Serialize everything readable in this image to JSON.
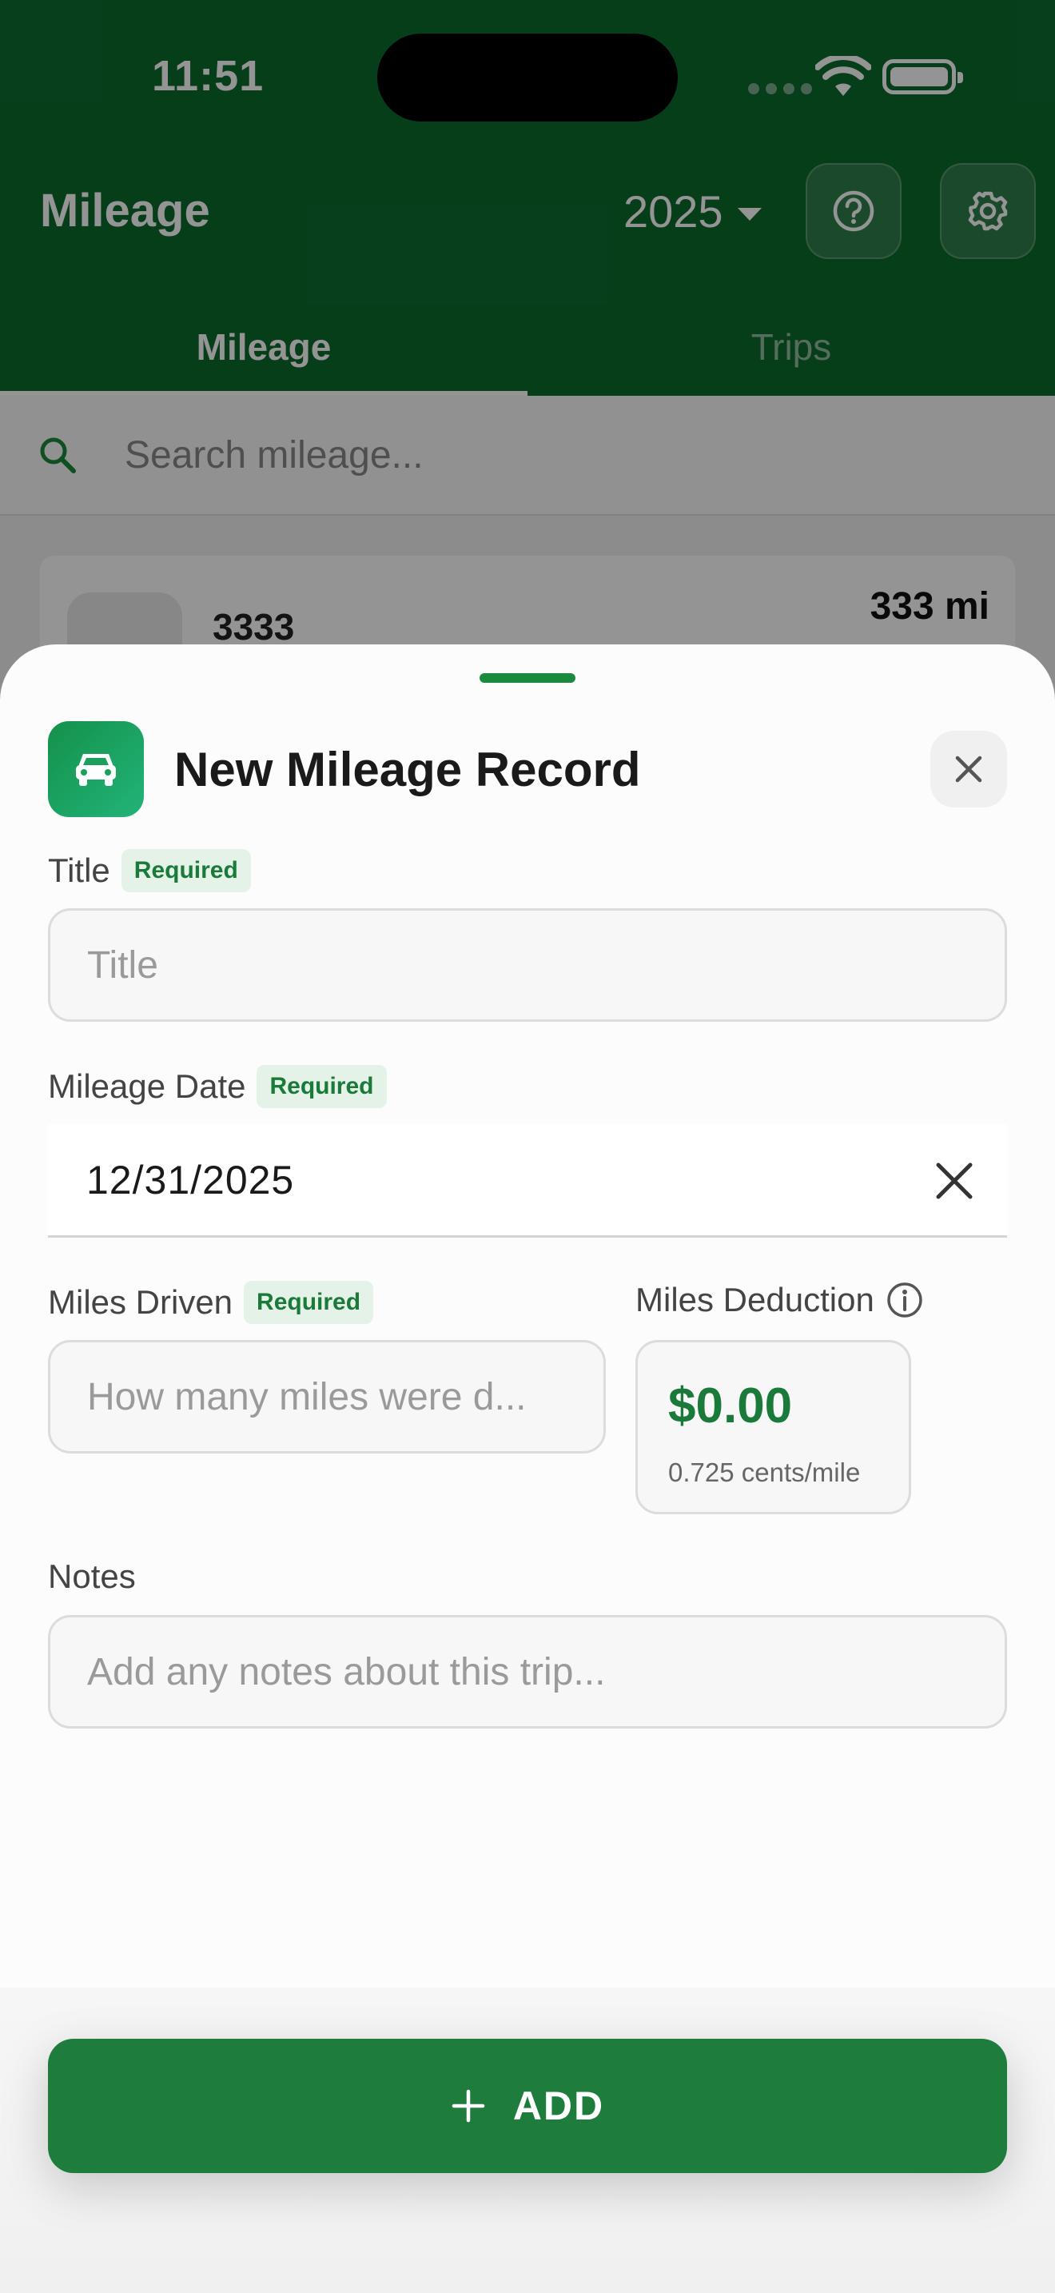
{
  "status_bar": {
    "time": "11:51"
  },
  "header": {
    "title": "Mileage",
    "year": "2025",
    "tabs": [
      {
        "label": "Mileage",
        "active": true
      },
      {
        "label": "Trips",
        "active": false
      }
    ]
  },
  "search": {
    "placeholder": "Search mileage..."
  },
  "list": {
    "items": [
      {
        "title": "3333",
        "miles": "333 mi"
      }
    ]
  },
  "sheet": {
    "title": "New Mileage Record",
    "required_badge": "Required",
    "title_field": {
      "label": "Title",
      "placeholder": "Title",
      "value": ""
    },
    "date_field": {
      "label": "Mileage Date",
      "value": "12/31/2025"
    },
    "miles_field": {
      "label": "Miles Driven",
      "placeholder": "How many miles were d...",
      "value": ""
    },
    "deduction": {
      "label": "Miles Deduction",
      "amount": "$0.00",
      "rate": "0.725 cents/mile"
    },
    "notes_field": {
      "label": "Notes",
      "placeholder": "Add any notes about this trip...",
      "value": ""
    },
    "add_button": {
      "label": "ADD"
    }
  },
  "colors": {
    "brand_green": "#0c6b2e",
    "accent_green": "#1e7d3c",
    "badge_bg": "#e4f2e7",
    "badge_text": "#1a7a3a"
  },
  "icons": {
    "help": "question-circle-icon",
    "settings": "gear-icon",
    "search": "search-icon",
    "car": "car-icon",
    "close": "close-icon",
    "clear": "clear-icon",
    "info": "info-icon",
    "add": "plus-icon"
  }
}
